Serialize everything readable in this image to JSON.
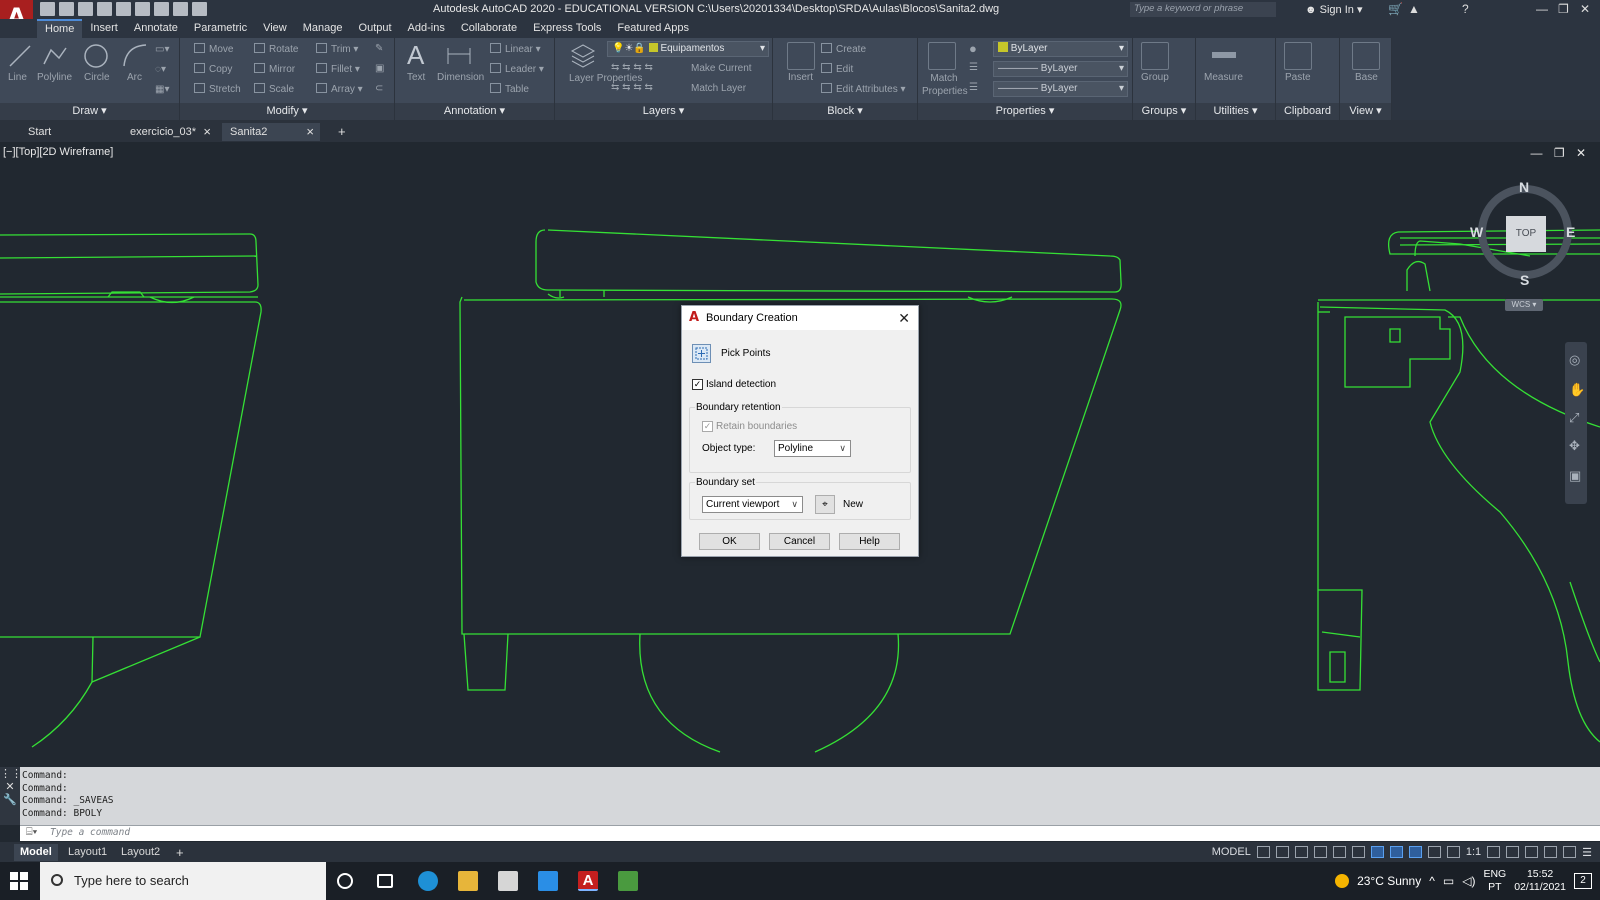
{
  "app": {
    "title": "Autodesk AutoCAD 2020 - EDUCATIONAL VERSION    C:\\Users\\20201334\\Desktop\\SRDA\\Aulas\\Blocos\\Sanita2.dwg",
    "search_placeholder": "Type a keyword or phrase",
    "sign_in": "Sign In"
  },
  "menu": [
    "Home",
    "Insert",
    "Annotate",
    "Parametric",
    "View",
    "Manage",
    "Output",
    "Add-ins",
    "Collaborate",
    "Express Tools",
    "Featured Apps"
  ],
  "ribbon": {
    "draw": {
      "label": "Draw ▾",
      "tools": [
        "Line",
        "Polyline",
        "Circle",
        "Arc"
      ]
    },
    "modify": {
      "label": "Modify ▾",
      "tools": [
        "Move",
        "Rotate",
        "Trim",
        "Copy",
        "Mirror",
        "Fillet",
        "Stretch",
        "Scale",
        "Array"
      ]
    },
    "annotation": {
      "label": "Annotation ▾",
      "tools": [
        "Text",
        "Dimension",
        "Linear",
        "Leader",
        "Table"
      ]
    },
    "layers": {
      "label": "Layers ▾",
      "layer_props": "Layer Properties",
      "current_layer": "Equipamentos",
      "tools": [
        "Make Current",
        "Match Layer"
      ]
    },
    "block": {
      "label": "Block ▾",
      "insert": "Insert",
      "tools": [
        "Create",
        "Edit",
        "Edit Attributes"
      ]
    },
    "properties": {
      "label": "Properties ▾",
      "match": "Match Properties",
      "color": "ByLayer",
      "linetype": "ByLayer",
      "lineweight": "ByLayer"
    },
    "groups": {
      "label": "Groups ▾",
      "group": "Group"
    },
    "utilities": {
      "label": "Utilities ▾",
      "measure": "Measure"
    },
    "clipboard": {
      "label": "Clipboard",
      "paste": "Paste"
    },
    "view": {
      "label": "View ▾",
      "base": "Base"
    }
  },
  "doc_tabs": [
    "Start",
    "exercicio_03*",
    "Sanita2"
  ],
  "viewport": {
    "label": "[−][Top][2D Wireframe]",
    "viewcube": {
      "n": "N",
      "s": "S",
      "e": "E",
      "w": "W",
      "face": "TOP",
      "wcs": "WCS ▾"
    }
  },
  "dialog": {
    "title": "Boundary Creation",
    "pick_points": "Pick Points",
    "island_detection": "Island detection",
    "island_checked": true,
    "boundary_retention": "Boundary retention",
    "retain_boundaries": "Retain boundaries",
    "object_type_label": "Object type:",
    "object_type": "Polyline",
    "boundary_set": "Boundary set",
    "boundary_set_value": "Current viewport",
    "new": "New",
    "ok": "OK",
    "cancel": "Cancel",
    "help": "Help"
  },
  "command": {
    "history": [
      "Command:",
      "Command:",
      "Command: _SAVEAS",
      "Command: BPOLY"
    ],
    "placeholder": "Type a command"
  },
  "layout_tabs": [
    "Model",
    "Layout1",
    "Layout2"
  ],
  "status": {
    "model": "MODEL",
    "scale": "1:1"
  },
  "taskbar": {
    "search": "Type here to search",
    "weather": "23°C  Sunny",
    "lang1": "ENG",
    "lang2": "PT",
    "time": "15:52",
    "date": "02/11/2021",
    "notif": "2"
  },
  "colors": {
    "drawing": "#35e035",
    "accent": "#4d8bd8",
    "canvas": "#212830"
  }
}
